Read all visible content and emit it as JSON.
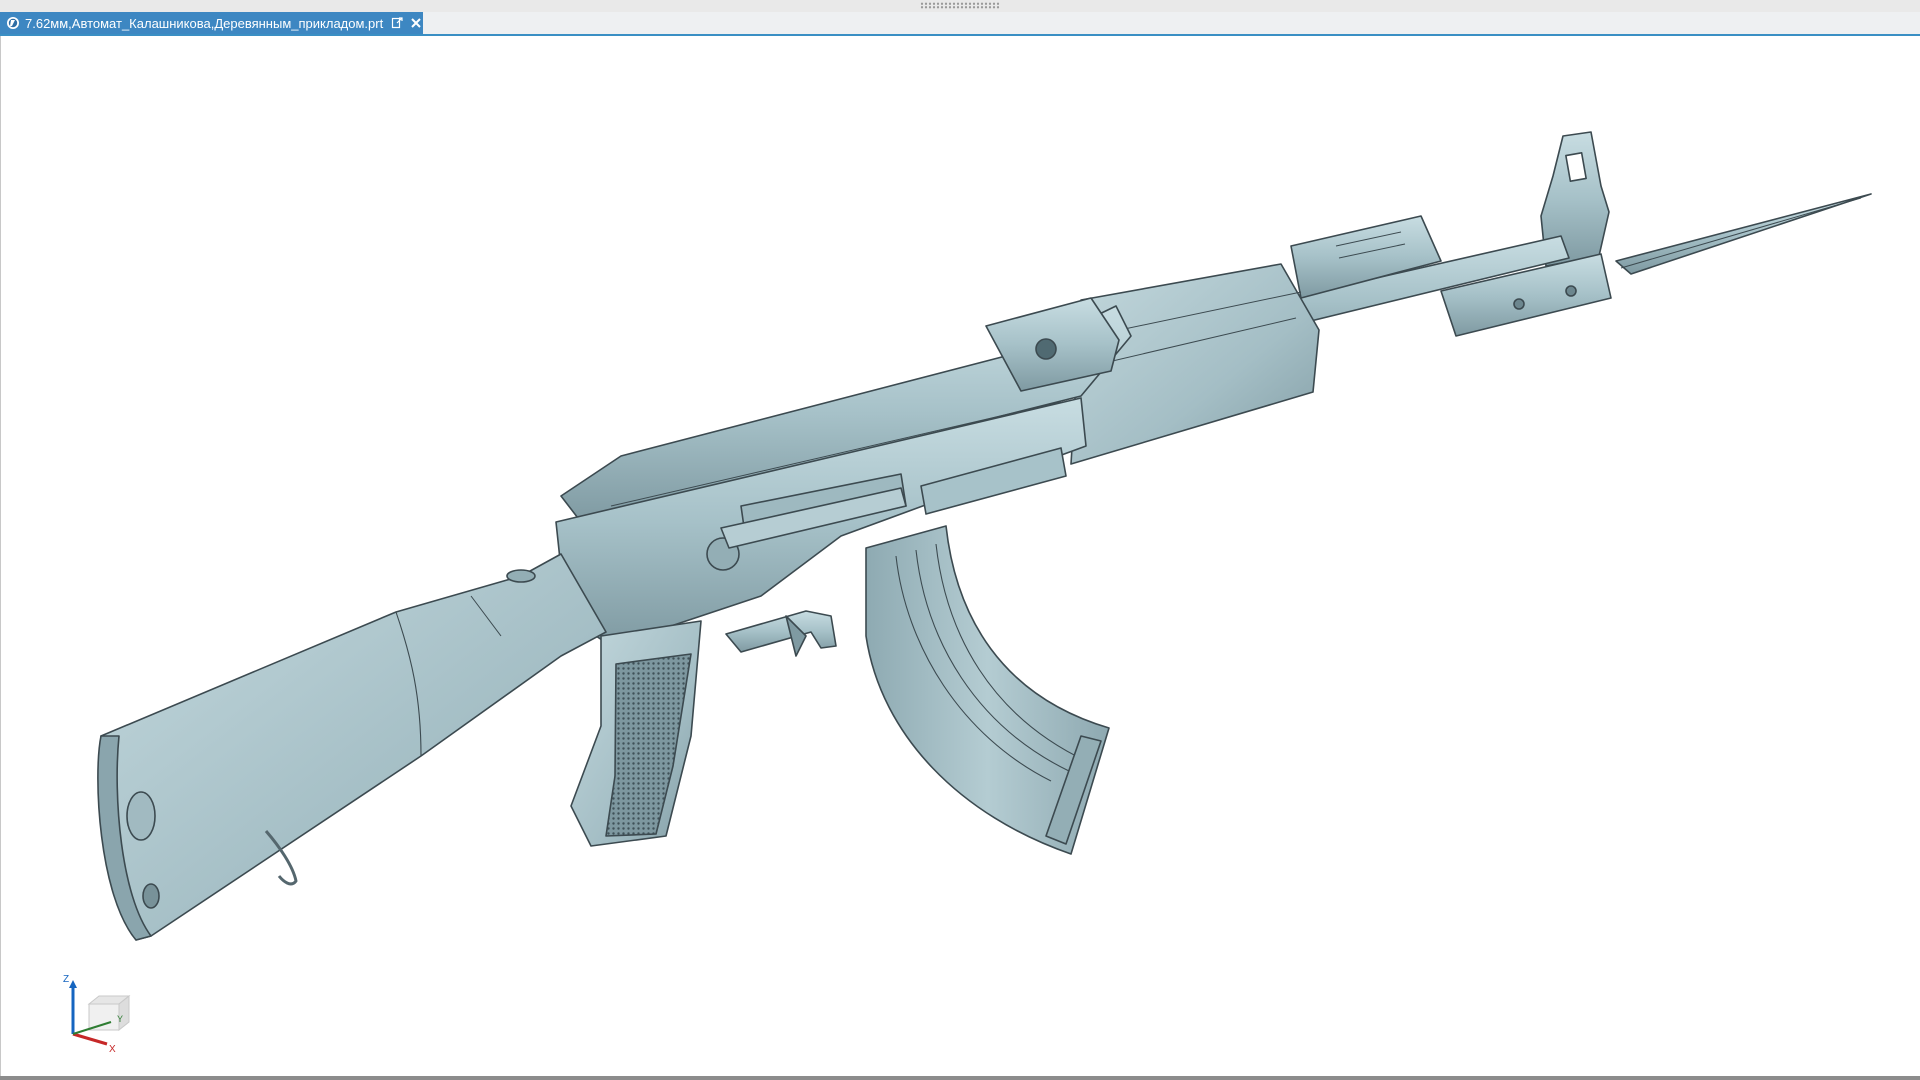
{
  "document_tab": {
    "title": "7.62мм,Автомат_Калашникова,Деревянным_прикладом.prt",
    "app_icon": "nx-app-icon",
    "pop_out_icon": "pop-out-icon",
    "close_icon": "close-icon",
    "active_color": "#3d87c2"
  },
  "viewport": {
    "background": "#ffffff",
    "model_color": "#a9c4cb",
    "edge_color": "#3c4a50"
  },
  "triad": {
    "z_label": "Z",
    "y_label": "Y",
    "x_label": "X",
    "z_color": "#1565c0",
    "y_color": "#2e7d32",
    "x_color": "#c62828"
  }
}
